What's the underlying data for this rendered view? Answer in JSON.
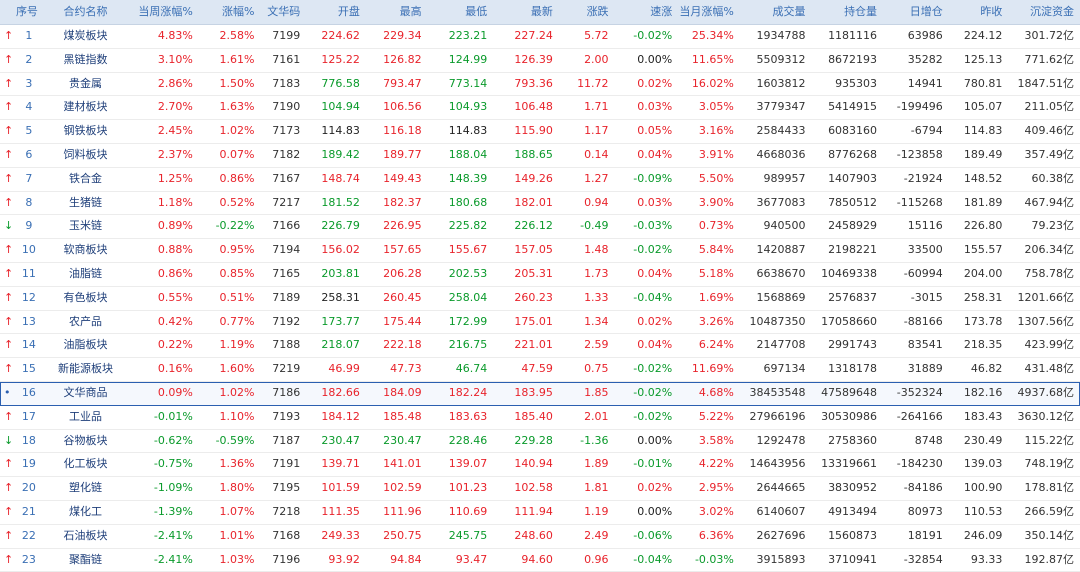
{
  "columns": {
    "idx": "序号",
    "name": "合约名称",
    "wk": "当周涨幅%",
    "pct": "涨幅%",
    "code": "文华码",
    "open": "开盘",
    "high": "最高",
    "low": "最低",
    "last": "最新",
    "chg": "涨跌",
    "spd": "速涨",
    "mon": "当月涨幅%",
    "vol": "成交量",
    "oi": "持仓量",
    "doi": "日增仓",
    "pc": "昨收",
    "cap": "沉淀资金"
  },
  "rows": [
    {
      "mark": "up",
      "idx": "1",
      "name": "煤炭板块",
      "wk": "4.83%",
      "pct": "2.58%",
      "code": "7199",
      "open": "224.62",
      "high": "229.34",
      "low": "223.21",
      "last": "227.24",
      "chg": "5.72",
      "spd": "-0.02%",
      "mon": "25.34%",
      "vol": "1934788",
      "oi": "1181116",
      "doi": "63986",
      "pc": "224.12",
      "cap": "301.72亿"
    },
    {
      "mark": "up",
      "idx": "2",
      "name": "黑链指数",
      "wk": "3.10%",
      "pct": "1.61%",
      "code": "7161",
      "open": "125.22",
      "high": "126.82",
      "low": "124.99",
      "last": "126.39",
      "chg": "2.00",
      "spd": "0.00%",
      "mon": "11.65%",
      "vol": "5509312",
      "oi": "8672193",
      "doi": "35282",
      "pc": "125.13",
      "cap": "771.62亿"
    },
    {
      "mark": "up",
      "idx": "3",
      "name": "贵金属",
      "wk": "2.86%",
      "pct": "1.50%",
      "code": "7183",
      "open": "776.58",
      "high": "793.47",
      "low": "773.14",
      "last": "793.36",
      "chg": "11.72",
      "spd": "0.02%",
      "mon": "16.02%",
      "vol": "1603812",
      "oi": "935303",
      "doi": "14941",
      "pc": "780.81",
      "cap": "1847.51亿"
    },
    {
      "mark": "up",
      "idx": "4",
      "name": "建材板块",
      "wk": "2.70%",
      "pct": "1.63%",
      "code": "7190",
      "open": "104.94",
      "high": "106.56",
      "low": "104.93",
      "last": "106.48",
      "chg": "1.71",
      "spd": "0.03%",
      "mon": "3.05%",
      "vol": "3779347",
      "oi": "5414915",
      "doi": "-199496",
      "pc": "105.07",
      "cap": "211.05亿"
    },
    {
      "mark": "up",
      "idx": "5",
      "name": "钢铁板块",
      "wk": "2.45%",
      "pct": "1.02%",
      "code": "7173",
      "open": "114.83",
      "high": "116.18",
      "low": "114.83",
      "last": "115.90",
      "chg": "1.17",
      "spd": "0.05%",
      "mon": "3.16%",
      "vol": "2584433",
      "oi": "6083160",
      "doi": "-6794",
      "pc": "114.83",
      "cap": "409.46亿"
    },
    {
      "mark": "up",
      "idx": "6",
      "name": "饲料板块",
      "wk": "2.37%",
      "pct": "0.07%",
      "code": "7182",
      "open": "189.42",
      "high": "189.77",
      "low": "188.04",
      "last": "188.65",
      "chg": "0.14",
      "spd": "0.04%",
      "mon": "3.91%",
      "vol": "4668036",
      "oi": "8776268",
      "doi": "-123858",
      "pc": "189.49",
      "cap": "357.49亿"
    },
    {
      "mark": "up",
      "idx": "7",
      "name": "铁合金",
      "wk": "1.25%",
      "pct": "0.86%",
      "code": "7167",
      "open": "148.74",
      "high": "149.43",
      "low": "148.39",
      "last": "149.26",
      "chg": "1.27",
      "spd": "-0.09%",
      "mon": "5.50%",
      "vol": "989957",
      "oi": "1407903",
      "doi": "-21924",
      "pc": "148.52",
      "cap": "60.38亿"
    },
    {
      "mark": "up",
      "idx": "8",
      "name": "生猪链",
      "wk": "1.18%",
      "pct": "0.52%",
      "code": "7217",
      "open": "181.52",
      "high": "182.37",
      "low": "180.68",
      "last": "182.01",
      "chg": "0.94",
      "spd": "0.03%",
      "mon": "3.90%",
      "vol": "3677083",
      "oi": "7850512",
      "doi": "-115268",
      "pc": "181.89",
      "cap": "467.94亿"
    },
    {
      "mark": "dn",
      "idx": "9",
      "name": "玉米链",
      "wk": "0.89%",
      "pct": "-0.22%",
      "code": "7166",
      "open": "226.79",
      "high": "226.95",
      "low": "225.82",
      "last": "226.12",
      "chg": "-0.49",
      "spd": "-0.03%",
      "mon": "0.73%",
      "vol": "940500",
      "oi": "2458929",
      "doi": "15116",
      "pc": "226.80",
      "cap": "79.23亿"
    },
    {
      "mark": "up",
      "idx": "10",
      "name": "软商板块",
      "wk": "0.88%",
      "pct": "0.95%",
      "code": "7194",
      "open": "156.02",
      "high": "157.65",
      "low": "155.67",
      "last": "157.05",
      "chg": "1.48",
      "spd": "-0.02%",
      "mon": "5.84%",
      "vol": "1420887",
      "oi": "2198221",
      "doi": "33500",
      "pc": "155.57",
      "cap": "206.34亿"
    },
    {
      "mark": "up",
      "idx": "11",
      "name": "油脂链",
      "wk": "0.86%",
      "pct": "0.85%",
      "code": "7165",
      "open": "203.81",
      "high": "206.28",
      "low": "202.53",
      "last": "205.31",
      "chg": "1.73",
      "spd": "0.04%",
      "mon": "5.18%",
      "vol": "6638670",
      "oi": "10469338",
      "doi": "-60994",
      "pc": "204.00",
      "cap": "758.78亿"
    },
    {
      "mark": "up",
      "idx": "12",
      "name": "有色板块",
      "wk": "0.55%",
      "pct": "0.51%",
      "code": "7189",
      "open": "258.31",
      "high": "260.45",
      "low": "258.04",
      "last": "260.23",
      "chg": "1.33",
      "spd": "-0.04%",
      "mon": "1.69%",
      "vol": "1568869",
      "oi": "2576837",
      "doi": "-3015",
      "pc": "258.31",
      "cap": "1201.66亿"
    },
    {
      "mark": "up",
      "idx": "13",
      "name": "农产品",
      "wk": "0.42%",
      "pct": "0.77%",
      "code": "7192",
      "open": "173.77",
      "high": "175.44",
      "low": "172.99",
      "last": "175.01",
      "chg": "1.34",
      "spd": "0.02%",
      "mon": "3.26%",
      "vol": "10487350",
      "oi": "17058660",
      "doi": "-88166",
      "pc": "173.78",
      "cap": "1307.56亿"
    },
    {
      "mark": "up",
      "idx": "14",
      "name": "油脂板块",
      "wk": "0.22%",
      "pct": "1.19%",
      "code": "7188",
      "open": "218.07",
      "high": "222.18",
      "low": "216.75",
      "last": "221.01",
      "chg": "2.59",
      "spd": "0.04%",
      "mon": "6.24%",
      "vol": "2147708",
      "oi": "2991743",
      "doi": "83541",
      "pc": "218.35",
      "cap": "423.99亿"
    },
    {
      "mark": "up",
      "idx": "15",
      "name": "新能源板块",
      "wk": "0.16%",
      "pct": "1.60%",
      "code": "7219",
      "open": "46.99",
      "high": "47.73",
      "low": "46.74",
      "last": "47.59",
      "chg": "0.75",
      "spd": "-0.02%",
      "mon": "11.69%",
      "vol": "697134",
      "oi": "1318178",
      "doi": "31889",
      "pc": "46.82",
      "cap": "431.48亿"
    },
    {
      "mark": "sel",
      "idx": "16",
      "name": "文华商品",
      "wk": "0.09%",
      "pct": "1.02%",
      "code": "7186",
      "open": "182.66",
      "high": "184.09",
      "low": "182.24",
      "last": "183.95",
      "chg": "1.85",
      "spd": "-0.02%",
      "mon": "4.68%",
      "vol": "38453548",
      "oi": "47589648",
      "doi": "-352324",
      "pc": "182.16",
      "cap": "4937.68亿"
    },
    {
      "mark": "up",
      "idx": "17",
      "name": "工业品",
      "wk": "-0.01%",
      "pct": "1.10%",
      "code": "7193",
      "open": "184.12",
      "high": "185.48",
      "low": "183.63",
      "last": "185.40",
      "chg": "2.01",
      "spd": "-0.02%",
      "mon": "5.22%",
      "vol": "27966196",
      "oi": "30530986",
      "doi": "-264166",
      "pc": "183.43",
      "cap": "3630.12亿"
    },
    {
      "mark": "dn",
      "idx": "18",
      "name": "谷物板块",
      "wk": "-0.62%",
      "pct": "-0.59%",
      "code": "7187",
      "open": "230.47",
      "high": "230.47",
      "low": "228.46",
      "last": "229.28",
      "chg": "-1.36",
      "spd": "0.00%",
      "mon": "3.58%",
      "vol": "1292478",
      "oi": "2758360",
      "doi": "8748",
      "pc": "230.49",
      "cap": "115.22亿"
    },
    {
      "mark": "up",
      "idx": "19",
      "name": "化工板块",
      "wk": "-0.75%",
      "pct": "1.36%",
      "code": "7191",
      "open": "139.71",
      "high": "141.01",
      "low": "139.07",
      "last": "140.94",
      "chg": "1.89",
      "spd": "-0.01%",
      "mon": "4.22%",
      "vol": "14643956",
      "oi": "13319661",
      "doi": "-184230",
      "pc": "139.03",
      "cap": "748.19亿"
    },
    {
      "mark": "up",
      "idx": "20",
      "name": "塑化链",
      "wk": "-1.09%",
      "pct": "1.80%",
      "code": "7195",
      "open": "101.59",
      "high": "102.59",
      "low": "101.23",
      "last": "102.58",
      "chg": "1.81",
      "spd": "0.02%",
      "mon": "2.95%",
      "vol": "2644665",
      "oi": "3830952",
      "doi": "-84186",
      "pc": "100.90",
      "cap": "178.81亿"
    },
    {
      "mark": "up",
      "idx": "21",
      "name": "煤化工",
      "wk": "-1.39%",
      "pct": "1.07%",
      "code": "7218",
      "open": "111.35",
      "high": "111.96",
      "low": "110.69",
      "last": "111.94",
      "chg": "1.19",
      "spd": "0.00%",
      "mon": "3.02%",
      "vol": "6140607",
      "oi": "4913494",
      "doi": "80973",
      "pc": "110.53",
      "cap": "266.59亿"
    },
    {
      "mark": "up",
      "idx": "22",
      "name": "石油板块",
      "wk": "-2.41%",
      "pct": "1.01%",
      "code": "7168",
      "open": "249.33",
      "high": "250.75",
      "low": "245.75",
      "last": "248.60",
      "chg": "2.49",
      "spd": "-0.06%",
      "mon": "6.36%",
      "vol": "2627696",
      "oi": "1560873",
      "doi": "18191",
      "pc": "246.09",
      "cap": "350.14亿"
    },
    {
      "mark": "up",
      "idx": "23",
      "name": "聚酯链",
      "wk": "-2.41%",
      "pct": "1.03%",
      "code": "7196",
      "open": "93.92",
      "high": "94.84",
      "low": "93.47",
      "last": "94.60",
      "chg": "0.96",
      "spd": "-0.04%",
      "mon": "-0.03%",
      "vol": "3915893",
      "oi": "3710941",
      "doi": "-32854",
      "pc": "93.33",
      "cap": "192.87亿"
    }
  ],
  "colors": {
    "up": "#e8232b",
    "down": "#0a9a2b",
    "header_bg": "#dde7f3",
    "selected_border": "#2b5fb0"
  }
}
